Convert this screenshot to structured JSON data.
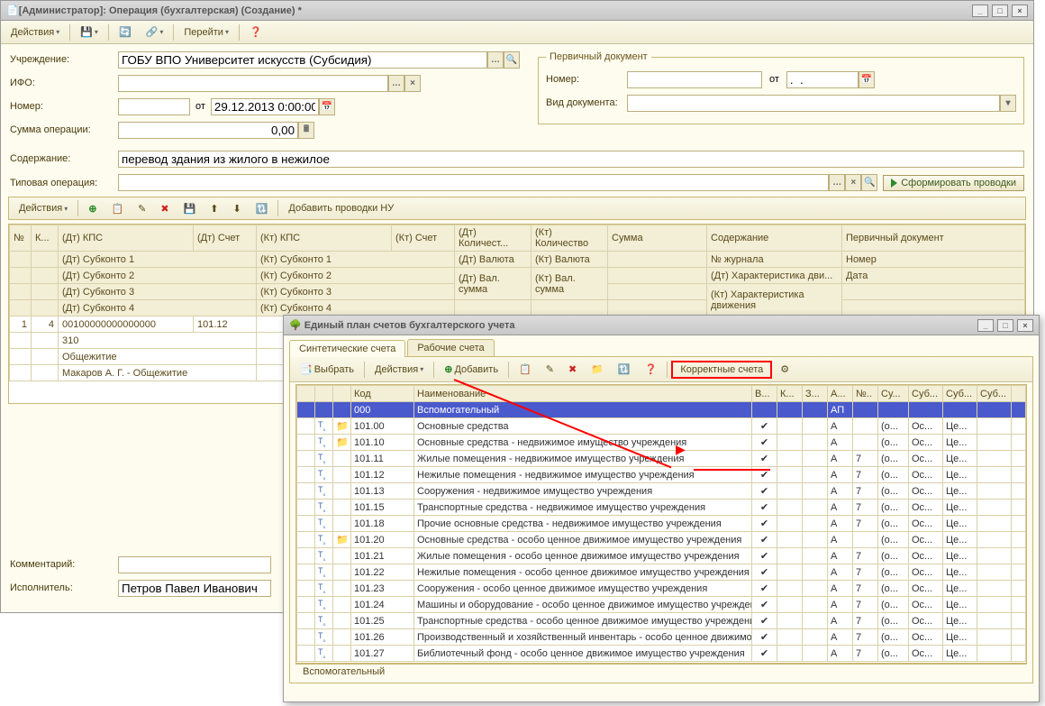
{
  "mainWindow": {
    "title": "[Администратор]: Операция (бухгалтерская) (Создание) *",
    "toolbar": {
      "actions": "Действия",
      "goto": "Перейти"
    },
    "form": {
      "org_label": "Учреждение:",
      "org_value": "ГОБУ ВПО Университет искусств (Субсидия)",
      "ifo_label": "ИФО:",
      "num_label": "Номер:",
      "date_from": "от",
      "date_value": "29.12.2013 0:00:00",
      "sum_label": "Сумма операции:",
      "sum_value": "0,00",
      "content_label": "Содержание:",
      "content_value": "перевод здания из жилого в нежилое",
      "typical_label": "Типовая операция:",
      "primary_doc": "Первичный документ",
      "pd_num": "Номер:",
      "pd_from": "от",
      "pd_date": ".  .",
      "pd_type": "Вид документа:"
    },
    "gridToolbar": {
      "actions": "Действия",
      "addNU": "Добавить проводки НУ",
      "generate": "Сформировать проводки"
    },
    "gridHeaders": {
      "n": "№",
      "k": "К...",
      "dt_kps": "(Дт) КПС",
      "dt_schet": "(Дт) Счет",
      "kt_kps": "(Кт) КПС",
      "kt_schet": "(Кт) Счет",
      "dt_kolich": "(Дт) Количест...",
      "kt_kolich": "(Кт) Количество",
      "summa": "Сумма",
      "soderzh": "Содержание",
      "perv": "Первичный документ",
      "dt_sub1": "(Дт) Субконто 1",
      "kt_sub1": "(Кт) Субконто 1",
      "dt_val": "(Дт) Валюта",
      "kt_val": "(Кт) Валюта",
      "nz": "№ журнала",
      "nomer": "Номер",
      "dt_sub2": "(Дт) Субконто 2",
      "kt_sub2": "(Кт) Субконто 2",
      "dt_vals": "(Дт) Вал. сумма",
      "kt_vals": "(Кт) Вал. сумма",
      "dt_har": "(Дт) Характеристика дви...",
      "data": "Дата",
      "dt_sub3": "(Дт) Субконто 3",
      "kt_sub3": "(Кт) Субконто 3",
      "kt_har": "(Кт) Характеристика движения",
      "dt_sub4": "(Дт) Субконто 4",
      "kt_sub4": "(Кт) Субконто 4"
    },
    "gridRow": {
      "n": "1",
      "k": "4",
      "dt_kps": "00100000000000000",
      "dt_schet": "101.12",
      "r310": "310",
      "obsh": "Общежитие",
      "makarov": "Макаров А. Г. - Общежитие"
    },
    "bottom": {
      "comment": "Комментарий:",
      "executor_label": "Исполнитель:",
      "executor_value": "Петров Павел Иванович"
    }
  },
  "popup": {
    "title": "Единый план счетов бухгалтерского учета",
    "tabs": {
      "synth": "Синтетические счета",
      "work": "Рабочие счета"
    },
    "toolbar": {
      "select": "Выбрать",
      "actions": "Действия",
      "add": "Добавить",
      "correct": "Корректные счета"
    },
    "headers": {
      "kod": "Код",
      "naim": "Наименование",
      "v": "В...",
      "k": "К...",
      "z": "З...",
      "a": "А...",
      "n": "№..",
      "su1": "Су...",
      "sub1": "Суб...",
      "sub2": "Суб...",
      "sub3": "Суб..."
    },
    "rows": [
      {
        "folder": false,
        "icon": "dot",
        "code": "000",
        "name": "Вспомогательный",
        "v": "",
        "k": "",
        "a": "АП",
        "n": "",
        "s1": "",
        "s2": "",
        "s3": ""
      },
      {
        "folder": true,
        "icon": "T",
        "code": "101.00",
        "name": "Основные средства",
        "v": "✔",
        "k": "",
        "a": "А",
        "n": "",
        "s1": "(о...",
        "s2": "Ос...",
        "s3": "Це..."
      },
      {
        "folder": true,
        "icon": "T",
        "code": "101.10",
        "name": "Основные средства - недвижимое имущество учреждения",
        "v": "✔",
        "k": "",
        "a": "А",
        "n": "",
        "s1": "(о...",
        "s2": "Ос...",
        "s3": "Це..."
      },
      {
        "folder": false,
        "icon": "T",
        "code": "101.11",
        "name": "Жилые помещения - недвижимое имущество учреждения",
        "v": "✔",
        "k": "",
        "a": "А",
        "n": "7",
        "s1": "(о...",
        "s2": "Ос...",
        "s3": "Це..."
      },
      {
        "folder": false,
        "icon": "T",
        "code": "101.12",
        "name": "Нежилые помещения - недвижимое имущество учреждения",
        "v": "✔",
        "k": "",
        "a": "А",
        "n": "7",
        "s1": "(о...",
        "s2": "Ос...",
        "s3": "Це..."
      },
      {
        "folder": false,
        "icon": "T",
        "code": "101.13",
        "name": "Сооружения - недвижимое имущество учреждения",
        "v": "✔",
        "k": "",
        "a": "А",
        "n": "7",
        "s1": "(о...",
        "s2": "Ос...",
        "s3": "Це..."
      },
      {
        "folder": false,
        "icon": "T",
        "code": "101.15",
        "name": "Транспортные средства - недвижимое имущество учреждения",
        "v": "✔",
        "k": "",
        "a": "А",
        "n": "7",
        "s1": "(о...",
        "s2": "Ос...",
        "s3": "Це..."
      },
      {
        "folder": false,
        "icon": "T",
        "code": "101.18",
        "name": "Прочие основные средства - недвижимое имущество учреждения",
        "v": "✔",
        "k": "",
        "a": "А",
        "n": "7",
        "s1": "(о...",
        "s2": "Ос...",
        "s3": "Це..."
      },
      {
        "folder": true,
        "icon": "T",
        "code": "101.20",
        "name": "Основные средства - особо ценное движимое имущество учреждения",
        "v": "✔",
        "k": "",
        "a": "А",
        "n": "",
        "s1": "(о...",
        "s2": "Ос...",
        "s3": "Це..."
      },
      {
        "folder": false,
        "icon": "T",
        "code": "101.21",
        "name": "Жилые помещения - особо ценное движимое имущество учреждения",
        "v": "✔",
        "k": "",
        "a": "А",
        "n": "7",
        "s1": "(о...",
        "s2": "Ос...",
        "s3": "Це..."
      },
      {
        "folder": false,
        "icon": "T",
        "code": "101.22",
        "name": "Нежилые помещения - особо ценное движимое имущество учреждения",
        "v": "✔",
        "k": "",
        "a": "А",
        "n": "7",
        "s1": "(о...",
        "s2": "Ос...",
        "s3": "Це..."
      },
      {
        "folder": false,
        "icon": "T",
        "code": "101.23",
        "name": "Сооружения - особо ценное движимое имущество учреждения",
        "v": "✔",
        "k": "",
        "a": "А",
        "n": "7",
        "s1": "(о...",
        "s2": "Ос...",
        "s3": "Це..."
      },
      {
        "folder": false,
        "icon": "T",
        "code": "101.24",
        "name": "Машины и оборудование - особо ценное движимое имущество учреждения",
        "v": "✔",
        "k": "",
        "a": "А",
        "n": "7",
        "s1": "(о...",
        "s2": "Ос...",
        "s3": "Це..."
      },
      {
        "folder": false,
        "icon": "T",
        "code": "101.25",
        "name": "Транспортные средства - особо ценное движимое имущество учреждения",
        "v": "✔",
        "k": "",
        "a": "А",
        "n": "7",
        "s1": "(о...",
        "s2": "Ос...",
        "s3": "Це..."
      },
      {
        "folder": false,
        "icon": "T",
        "code": "101.26",
        "name": "Производственный и хозяйственный инвентарь - особо ценное движимое им...",
        "v": "✔",
        "k": "",
        "a": "А",
        "n": "7",
        "s1": "(о...",
        "s2": "Ос...",
        "s3": "Це..."
      },
      {
        "folder": false,
        "icon": "T",
        "code": "101.27",
        "name": "Библиотечный фонд - особо ценное движимое имущество учреждения",
        "v": "✔",
        "k": "",
        "a": "А",
        "n": "7",
        "s1": "(о...",
        "s2": "Ос...",
        "s3": "Це..."
      }
    ],
    "status": "Вспомогательный"
  }
}
